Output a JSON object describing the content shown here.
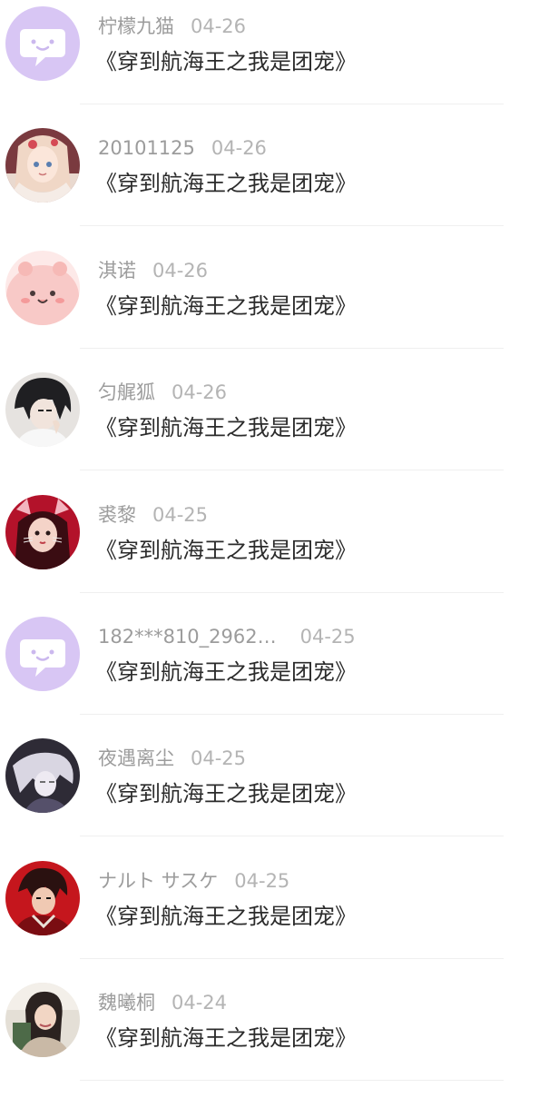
{
  "comments": [
    {
      "user": "柠檬九猫",
      "date": "04-26",
      "text": "《穿到航海王之我是团宠》",
      "avatar": "chat-bubble-default-avatar"
    },
    {
      "user": "20101125",
      "date": "04-26",
      "text": "《穿到航海王之我是团宠》",
      "avatar": "anime-girl-avatar"
    },
    {
      "user": "淇诺",
      "date": "04-26",
      "text": "《穿到航海王之我是团宠》",
      "avatar": "pink-cartoon-avatar"
    },
    {
      "user": "匀艉狐",
      "date": "04-26",
      "text": "《穿到航海王之我是团宠》",
      "avatar": "anime-boy-avatar"
    },
    {
      "user": "裘黎",
      "date": "04-25",
      "text": "《穿到航海王之我是团宠》",
      "avatar": "red-cat-ears-avatar"
    },
    {
      "user": "182***810_2962…",
      "date": "04-25",
      "text": "《穿到航海王之我是团宠》",
      "avatar": "chat-bubble-default-avatar"
    },
    {
      "user": "夜遇离尘",
      "date": "04-25",
      "text": "《穿到航海王之我是团宠》",
      "avatar": "dark-anime-avatar"
    },
    {
      "user": "ナルト サスケ",
      "date": "04-25",
      "text": "《穿到航海王之我是团宠》",
      "avatar": "red-anime-avatar"
    },
    {
      "user": "魏曦桐",
      "date": "04-24",
      "text": "《穿到航海王之我是团宠》",
      "avatar": "girl-photo-avatar"
    }
  ],
  "colors": {
    "default_avatar_bg": "#d8c6f4",
    "username": "#9c9c9c",
    "date": "#b4b4b4",
    "text": "#2b2b2b",
    "divider": "#efefef"
  }
}
